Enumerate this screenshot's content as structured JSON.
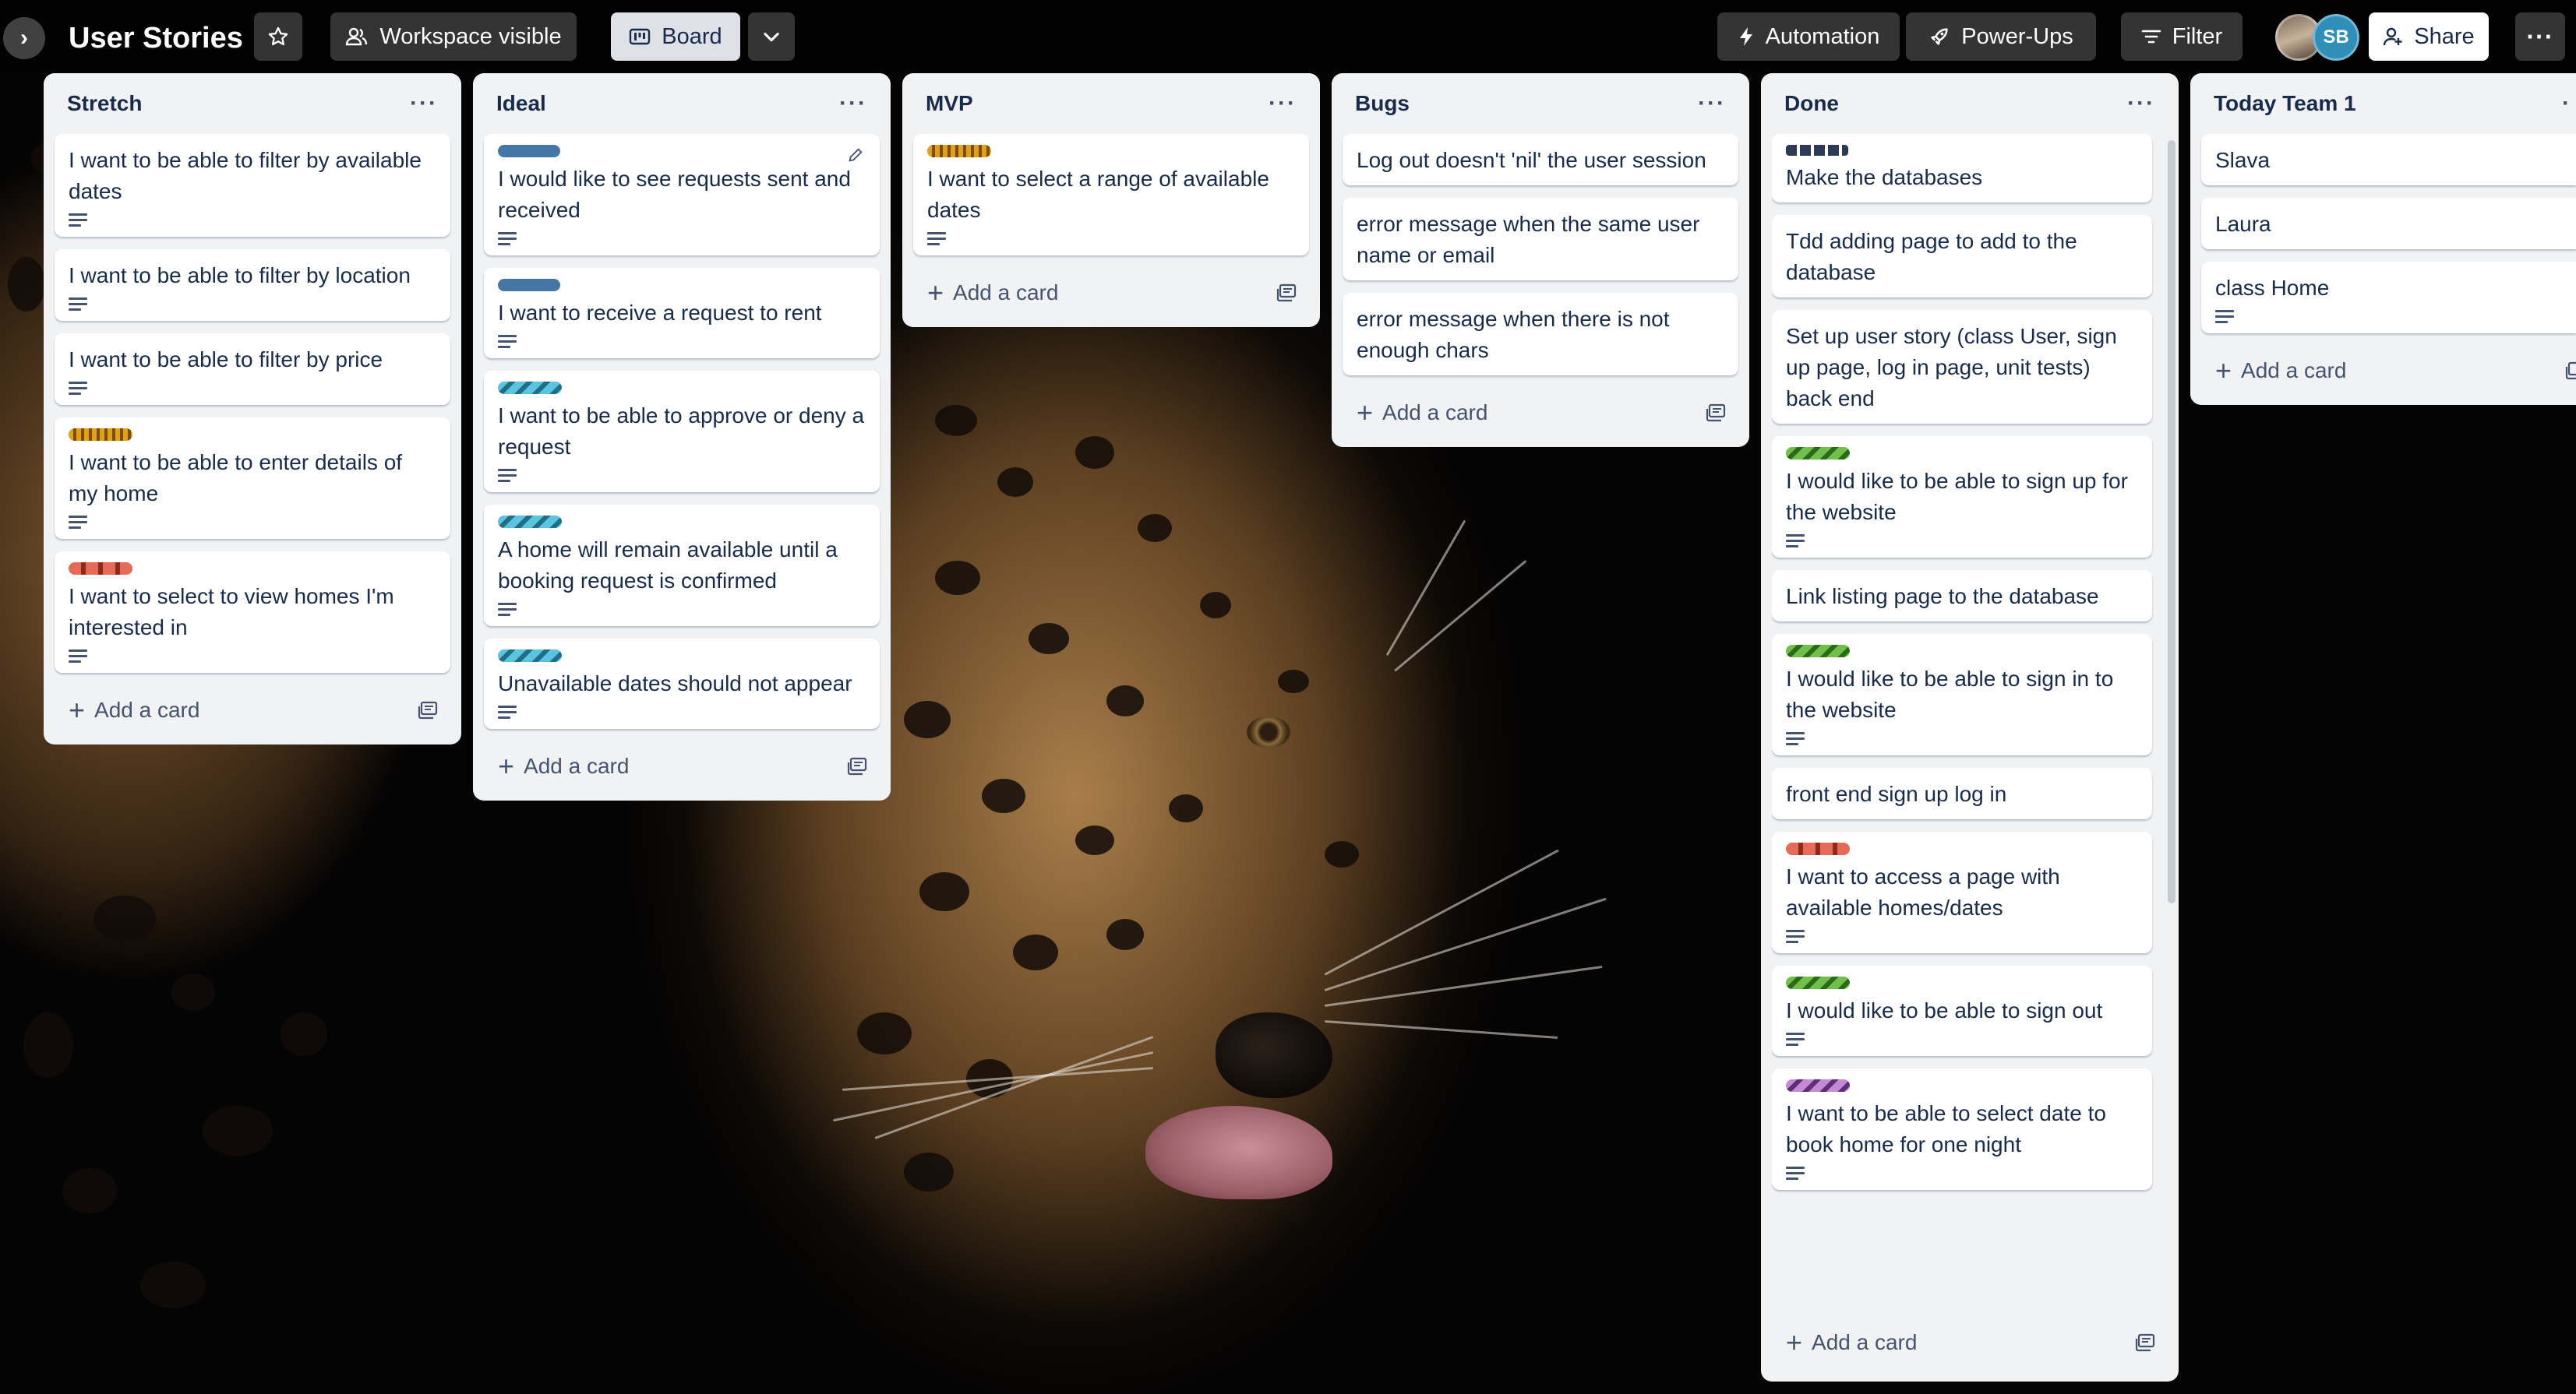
{
  "board": {
    "title": "User Stories",
    "visibility": "Workspace visible",
    "view": "Board"
  },
  "topbar_right": {
    "automation": "Automation",
    "power_ups": "Power-Ups",
    "filter": "Filter",
    "share": "Share",
    "avatar_initials": "SB"
  },
  "lists": {
    "stretch": {
      "title": "Stretch",
      "cards": [
        {
          "text": "I want to be able to filter by available dates"
        },
        {
          "text": "I want to be able to filter by location"
        },
        {
          "text": "I want to be able to filter by price"
        },
        {
          "text": "I want to be able to enter details of my home"
        },
        {
          "text": "I want to select to view homes I'm interested in"
        }
      ],
      "add": "Add a card"
    },
    "ideal": {
      "title": "Ideal",
      "cards": [
        {
          "text": "I would like to see requests sent and received"
        },
        {
          "text": "I want to receive a request to rent"
        },
        {
          "text": "I want to be able to approve or deny a request"
        },
        {
          "text": "A home will remain available until a booking request is confirmed"
        },
        {
          "text": "Unavailable dates should not appear"
        }
      ],
      "add": "Add a card"
    },
    "mvp": {
      "title": "MVP",
      "cards": [
        {
          "text": "I want to select a range of available dates"
        }
      ],
      "add": "Add a card"
    },
    "bugs": {
      "title": "Bugs",
      "cards": [
        {
          "text": "Log out doesn't 'nil' the user session"
        },
        {
          "text": "error message when the same user name or email"
        },
        {
          "text": "error message when there is not enough chars"
        }
      ],
      "add": "Add a card"
    },
    "done": {
      "title": "Done",
      "cards": [
        {
          "text": "Make the databases"
        },
        {
          "text": "Tdd adding page to add to the database"
        },
        {
          "text": "Set up user story (class User, sign up page, log in page, unit tests) back end"
        },
        {
          "text": "I would like to be able to sign up for the website"
        },
        {
          "text": "Link listing page to the database"
        },
        {
          "text": "I would like to be able to sign in to the website"
        },
        {
          "text": "front end sign up log in"
        },
        {
          "text": "I want to access a page with available homes/dates"
        },
        {
          "text": "I would like to be able to sign out"
        },
        {
          "text": "I want to be able to select date to book home for one night"
        }
      ],
      "add": "Add a card"
    },
    "today": {
      "title": "Today Team 1",
      "cards": [
        {
          "text": "Slava"
        },
        {
          "text": "Laura"
        },
        {
          "text": "class Home"
        }
      ],
      "add": "Add a card"
    }
  }
}
